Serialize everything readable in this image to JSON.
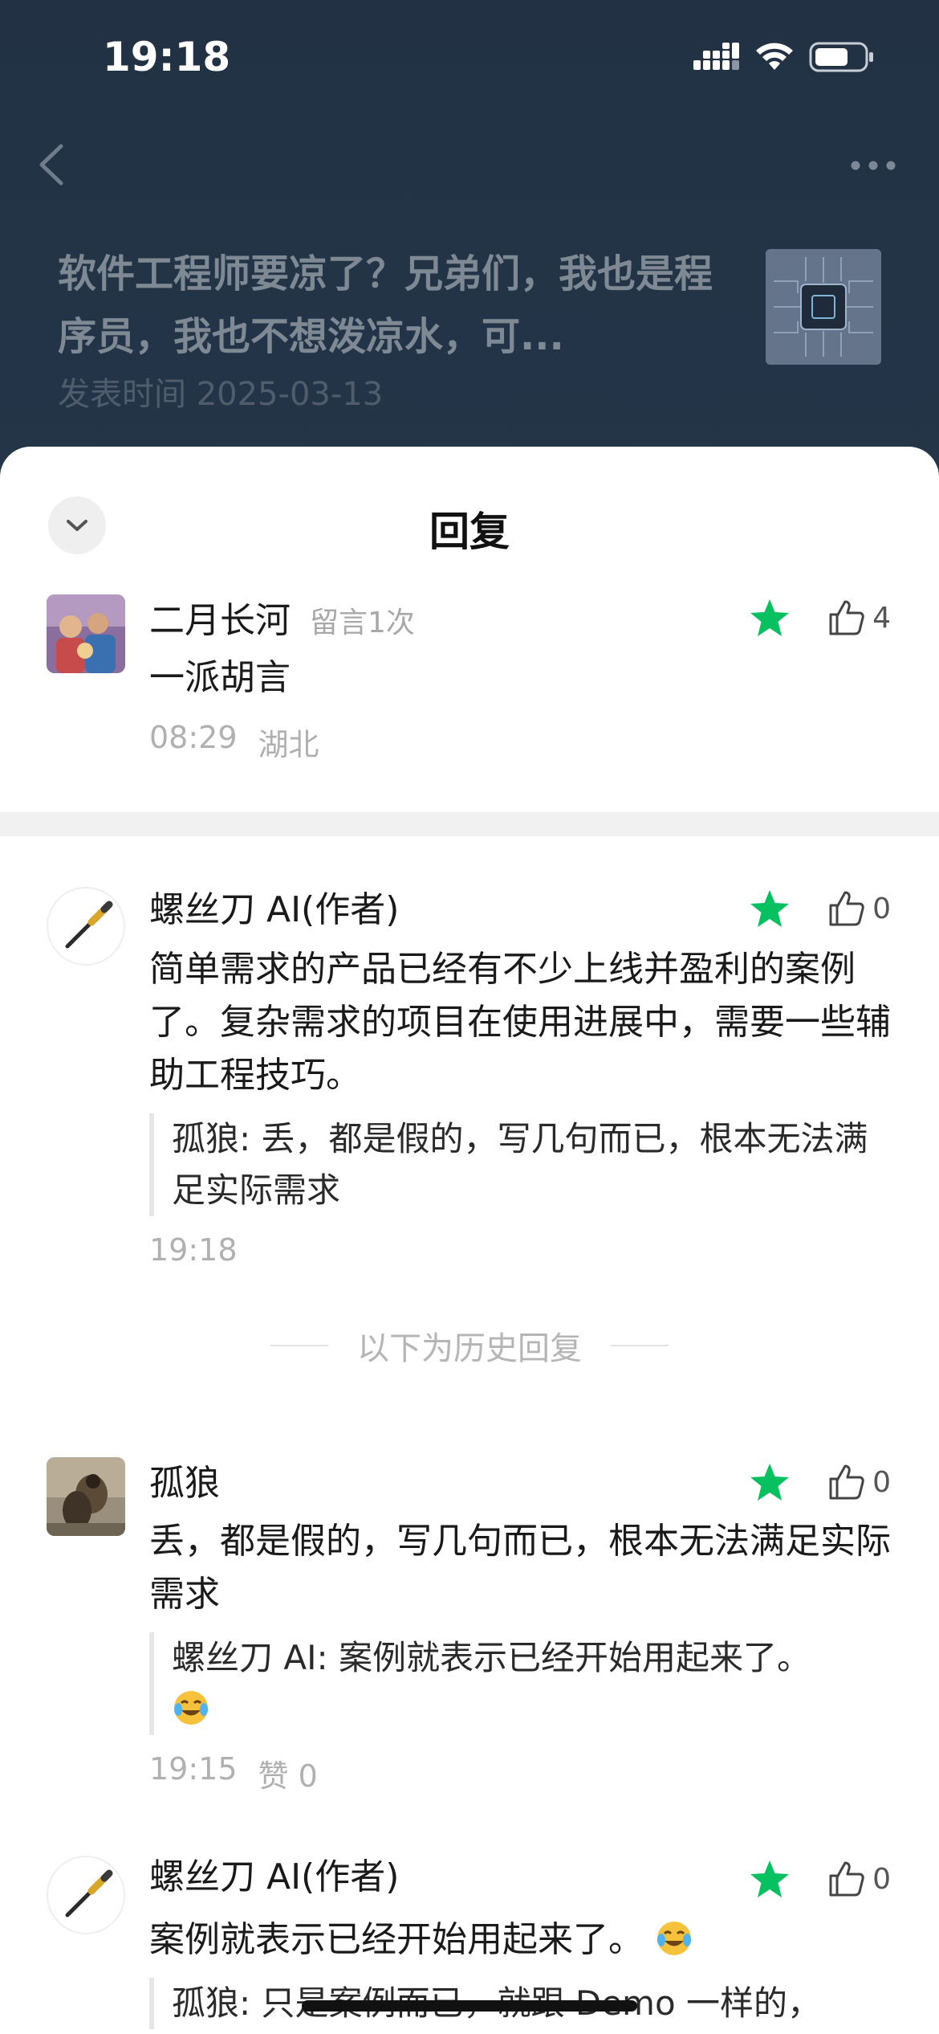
{
  "status_bar": {
    "time": "19:18"
  },
  "article": {
    "title": "软件工程师要凉了？兄弟们，我也是程序员，我也不想泼凉水，可...",
    "publish_time": "发表时间 2025-03-13"
  },
  "sheet": {
    "title": "回复"
  },
  "comments": [
    {
      "name": "二月长河",
      "comment_count": "留言1次",
      "likes": "4",
      "text": "一派胡言",
      "time": "08:29",
      "location": "湖北"
    },
    {
      "name": "螺丝刀 AI(作者)",
      "likes": "0",
      "text": "简单需求的产品已经有不少上线并盈利的案例了。复杂需求的项目在使用进展中，需要一些辅助工程技巧。",
      "quote": "孤狼: 丢，都是假的，写几句而已，根本无法满足实际需求",
      "time": "19:18"
    },
    {
      "name": "孤狼",
      "likes": "0",
      "text": "丢，都是假的，写几句而已，根本无法满足实际需求",
      "quote": "螺丝刀 AI: 案例就表示已经开始用起来了。",
      "time": "19:15",
      "likes_label": "赞 0"
    },
    {
      "name": "螺丝刀 AI(作者)",
      "likes": "0",
      "text": "案例就表示已经开始用起来了。",
      "quote": "孤狼: 只是案例而已，就跟 Demo 一样的，"
    }
  ],
  "history_divider": "以下为历史回复",
  "colors": {
    "header_bg": "#223244",
    "star_green": "#07c160",
    "muted_text": "#b0b0b0"
  },
  "icons": [
    "back-icon",
    "more-icon",
    "chevron-down-icon",
    "star-icon",
    "thumbs-up-icon",
    "tears-of-joy-emoji-icon",
    "screwdriver-icon"
  ]
}
